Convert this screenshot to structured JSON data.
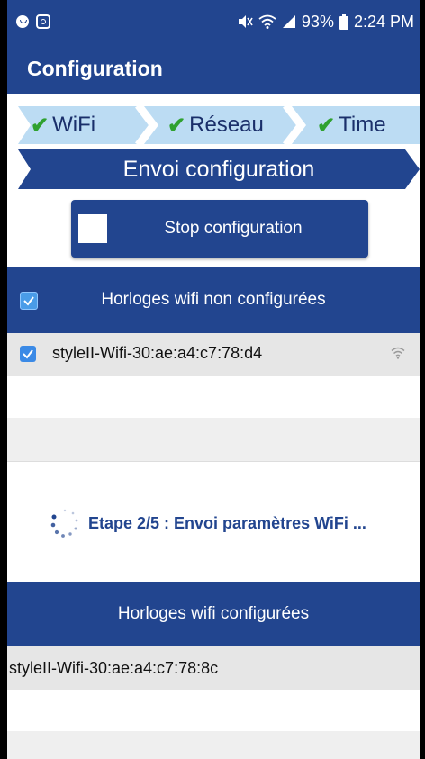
{
  "colors": {
    "primary": "#22458f",
    "step_light": "#bcdcf3",
    "step_text": "#1a2f6a",
    "check_green": "#2fa12f",
    "row_grey": "#e6e6e6"
  },
  "statusbar": {
    "left_icons": [
      "notification-dot-icon",
      "instagram-icon"
    ],
    "right_icons": [
      "mute-icon",
      "wifi-icon",
      "signal-icon",
      "battery-icon"
    ],
    "battery": "93%",
    "time": "2:24 PM"
  },
  "appbar": {
    "title": "Configuration"
  },
  "steps": [
    {
      "label": "WiFi",
      "done": true
    },
    {
      "label": "Réseau",
      "done": true
    },
    {
      "label": "Time",
      "done": true
    }
  ],
  "current_step": {
    "label": "Envoi configuration"
  },
  "check_glyph": "✔",
  "stop_button": {
    "label": "Stop configuration"
  },
  "unconfigured": {
    "header": "Horloges wifi non configurées",
    "select_all_checked": true,
    "items": [
      {
        "name": "styleII-Wifi-30:ae:a4:c7:78:d4",
        "checked": true,
        "icon": "wifi-signal-icon"
      }
    ]
  },
  "progress": {
    "text": "Etape 2/5 : Envoi paramètres WiFi ..."
  },
  "configured": {
    "header": "Horloges wifi configurées",
    "items": [
      {
        "name": "styleII-Wifi-30:ae:a4:c7:78:8c"
      }
    ]
  }
}
